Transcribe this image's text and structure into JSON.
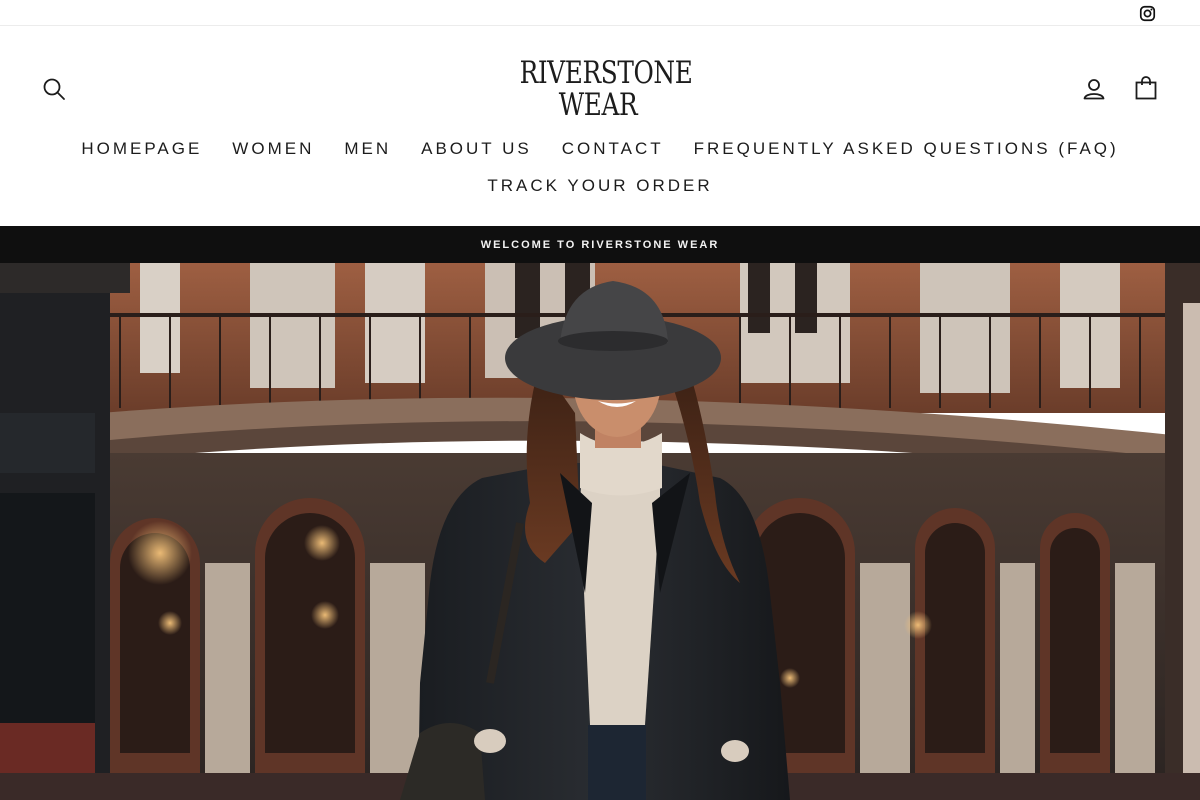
{
  "topbar": {
    "social_icon": "instagram-icon"
  },
  "header": {
    "logo_line1": "RIVERSTONE",
    "logo_line2": "WEAR",
    "search_icon": "search-icon",
    "account_icon": "user-icon",
    "cart_icon": "bag-icon"
  },
  "nav": {
    "items": [
      {
        "label": "HOMEPAGE"
      },
      {
        "label": "WOMEN"
      },
      {
        "label": "MEN"
      },
      {
        "label": "ABOUT US"
      },
      {
        "label": "CONTACT"
      },
      {
        "label": "FREQUENTLY ASKED QUESTIONS (FAQ)"
      },
      {
        "label": "TRACK YOUR ORDER"
      }
    ]
  },
  "announcement": {
    "text": "WELCOME TO RIVERSTONE WEAR"
  },
  "hero": {
    "image": "woman-in-hat-street-photo",
    "colors": {
      "brick": "#a8623f",
      "stone": "#d8cfc6",
      "dark": "#1a1a1c",
      "coat": "#1f2226",
      "sweater": "#dcd2c5",
      "hat": "#3d3d3f",
      "hair": "#4a2a1c",
      "skin": "#c98e6c"
    }
  },
  "colors": {
    "text": "#1c1c1c",
    "announce_bg": "#0f0f0f",
    "announce_text": "#f2f2f2"
  }
}
